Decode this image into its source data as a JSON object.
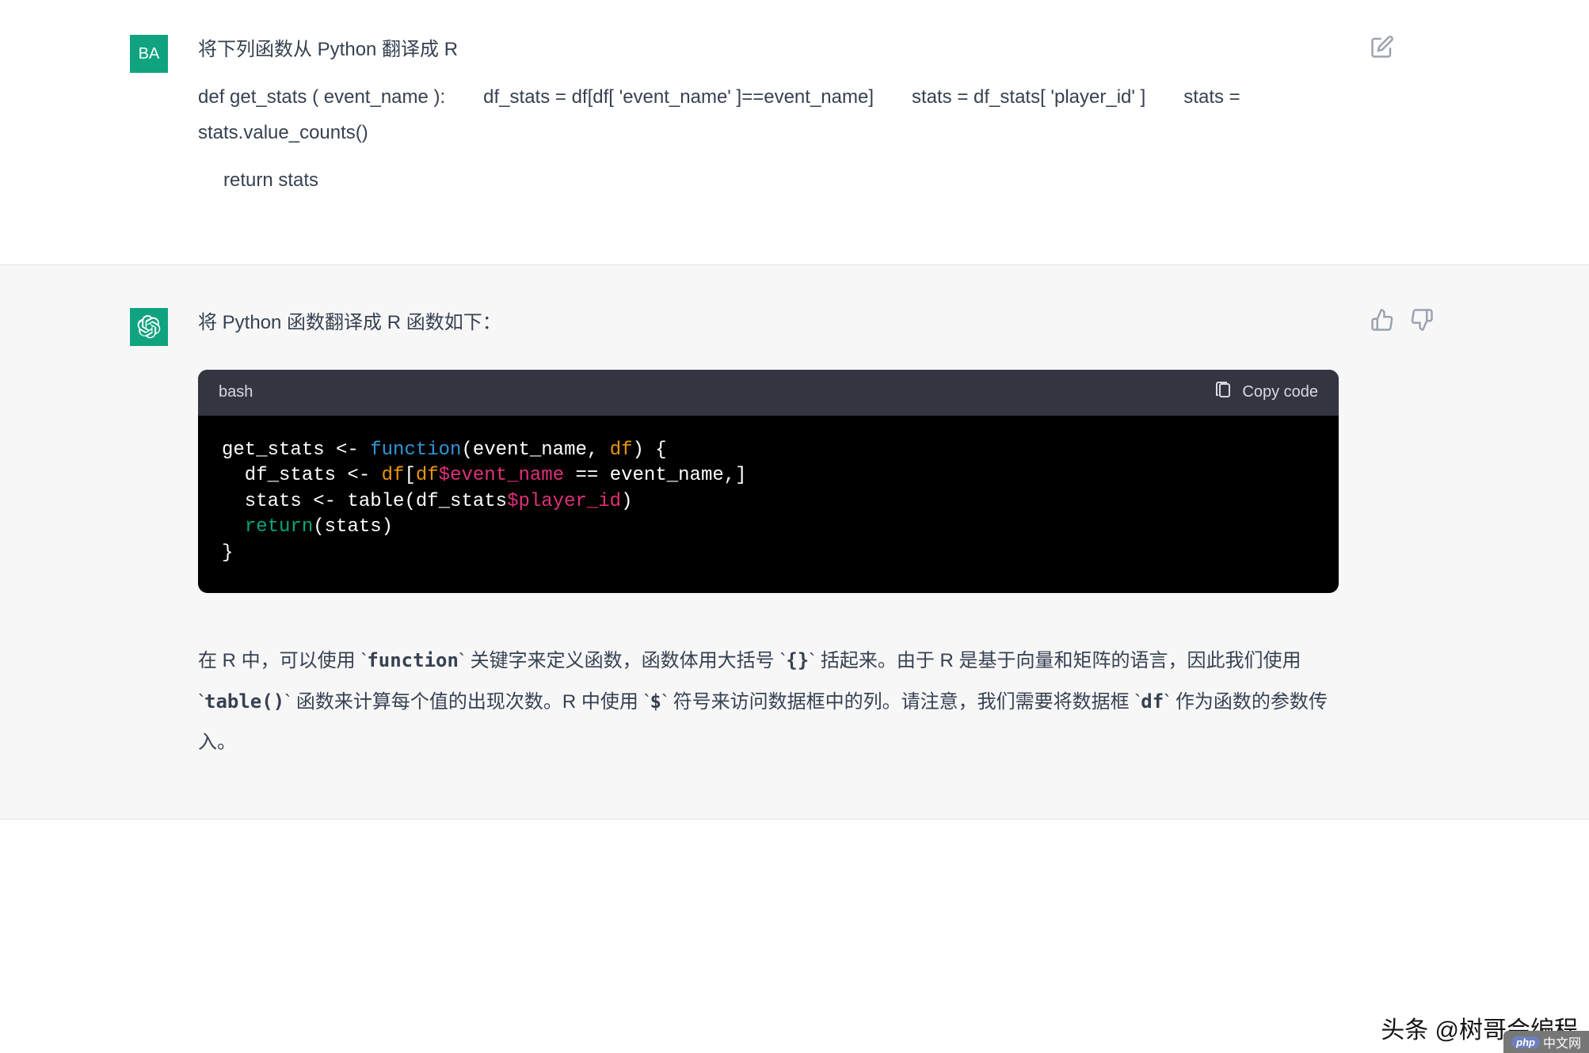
{
  "user": {
    "avatar": "BA",
    "prompt_title": "将下列函数从 Python 翻译成 R",
    "code_line1": "def get_stats ( event_name ):  df_stats = df[df[ 'event_name' ]==event_name]  stats = df_stats[ 'player_id' ]  stats = stats.value_counts()",
    "code_line2": "return stats"
  },
  "assistant": {
    "intro": "将 Python 函数翻译成 R 函数如下：",
    "code_lang": "bash",
    "copy_label": "Copy code",
    "code": {
      "l1": {
        "a": "get_stats <- ",
        "fn": "function",
        "b": "(event_name, ",
        "df": "df",
        "c": ") {"
      },
      "l2": {
        "a": "  df_stats <- ",
        "df": "df",
        "b": "[",
        "dfv": "df",
        "dol": "$event_name",
        "c": " == event_name,]"
      },
      "l3": {
        "a": "  stats <- table(df_stats",
        "dol": "$player_id",
        "b": ")"
      },
      "l4": {
        "ret": "return",
        "a": "(stats)"
      },
      "l5": "}"
    },
    "explain": {
      "p1a": "在 R 中，可以使用 `",
      "p1b": "function",
      "p1c": "` 关键字来定义函数，函数体用大括号 `",
      "p1d": "{}",
      "p1e": "` 括起来。由于 R 是基于向量和矩阵的语言，因此我们使用 `",
      "p1f": "table()",
      "p1g": "` 函数来计算每个值的出现次数。R 中使用 `",
      "p1h": "$",
      "p1i": "` 符号来访问数据框中的列。请注意，我们需要将数据框 `",
      "p1j": "df",
      "p1k": "` 作为函数的参数传入。"
    }
  },
  "watermark": "头条 @树哥会编程",
  "php": "中文网"
}
